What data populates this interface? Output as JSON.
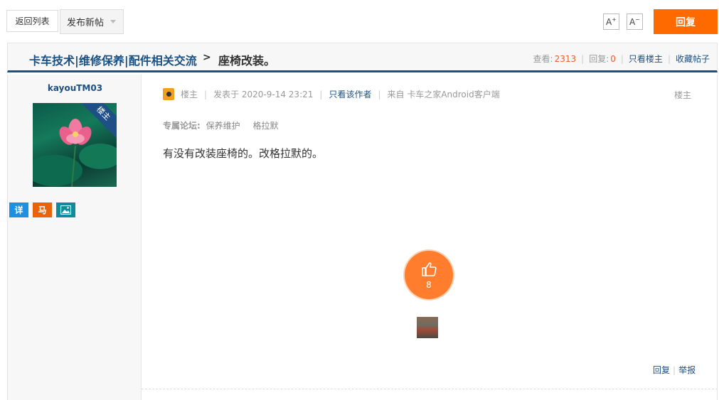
{
  "toolbar": {
    "back_label": "返回列表",
    "new_post_label": "发布新帖",
    "font_increase_label": "A",
    "font_decrease_label": "A",
    "reply_label": "回复"
  },
  "header": {
    "forum_name": "卡车技术|维修保养|配件相关交流",
    "separator": ">",
    "thread_title": "座椅改装。",
    "views_label": "查看:",
    "views": "2313",
    "replies_label": "回复:",
    "replies": "0",
    "author_only_label": "只看楼主",
    "favorite_label": "收藏帖子"
  },
  "author": {
    "username": "kayouTM03",
    "corner_badge": "楼主",
    "badges": [
      {
        "label": "详",
        "color": "#1e8fe1"
      },
      {
        "label": "马",
        "color": "#e8630a"
      },
      {
        "label": "",
        "icon": "image-icon",
        "color": "#138a9c"
      }
    ]
  },
  "post": {
    "author_role": "楼主",
    "posted_at": "发表于 2020-9-14 23:21",
    "author_only_label": "只看该作者",
    "source": "来自 卡车之家Android客户端",
    "floor_label": "楼主",
    "forum_label": "专属论坛:",
    "forum_tags": [
      "保养维护",
      "格拉默"
    ],
    "body": "有没有改装座椅的。改格拉默的。",
    "like_count": "8",
    "reply_label": "回复",
    "report_label": "举报"
  },
  "colors": {
    "accent": "#ff6a00",
    "link": "#1b5082",
    "count": "#f15a22"
  }
}
